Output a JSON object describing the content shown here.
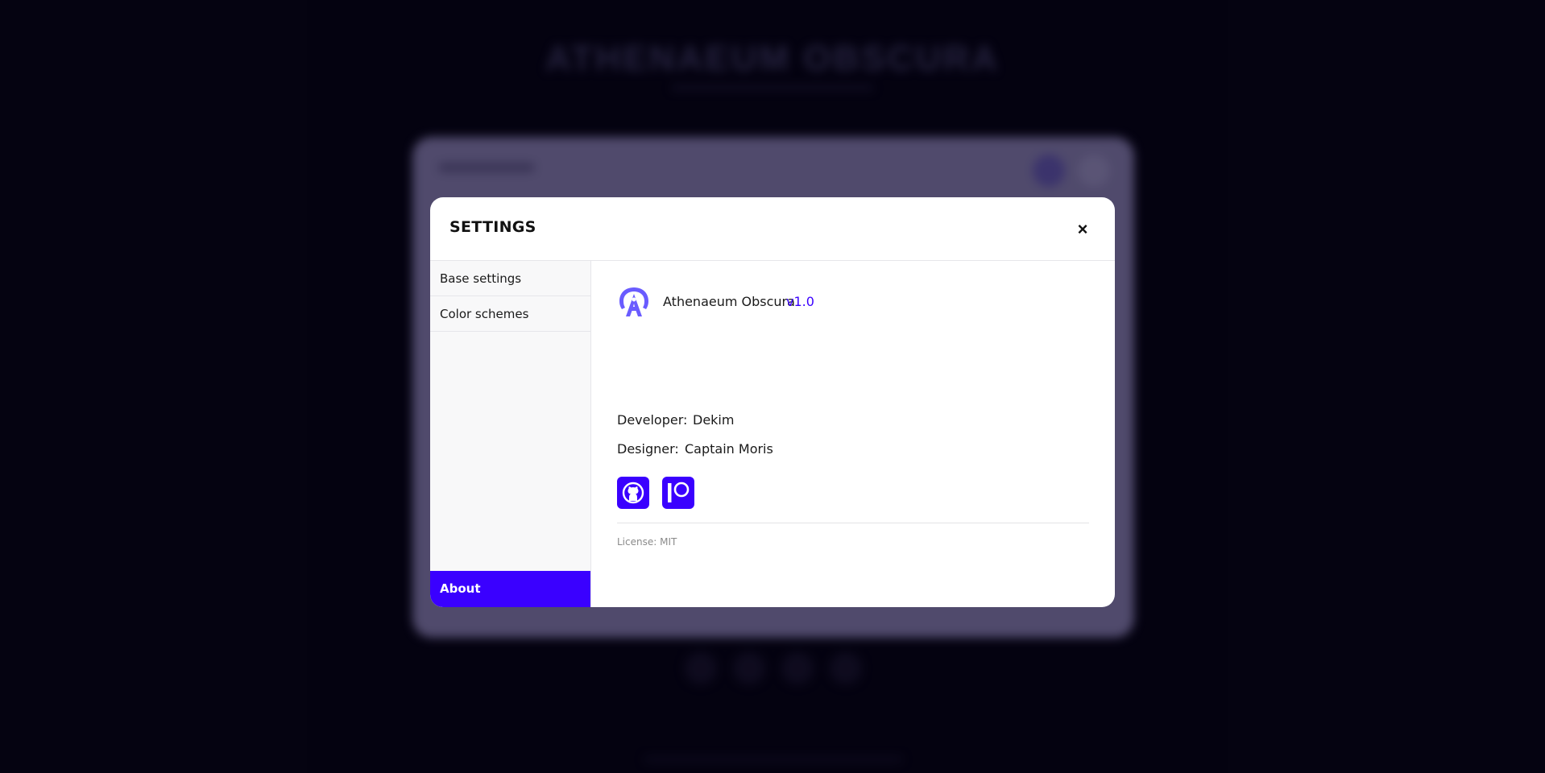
{
  "background_app": {
    "title": "ATHENAEUM OBSCURA"
  },
  "modal": {
    "title": "SETTINGS",
    "close_label": "×",
    "sidebar": {
      "items": [
        {
          "label": "Base settings",
          "active": false
        },
        {
          "label": "Color schemes",
          "active": false
        },
        {
          "label": "About",
          "active": true
        }
      ]
    },
    "about": {
      "app_name": "Athenaeum Obscura",
      "version": "v1.0",
      "developer_label": "Developer:",
      "developer_value": "Dekim",
      "designer_label": "Designer:",
      "designer_value": "Captain Moris",
      "links": [
        {
          "icon": "github-icon"
        },
        {
          "icon": "patreon-icon"
        }
      ],
      "license": "License: MIT"
    }
  },
  "colors": {
    "accent": "#3a00ff",
    "logo": "#6a5cff",
    "background": "#07041a"
  }
}
